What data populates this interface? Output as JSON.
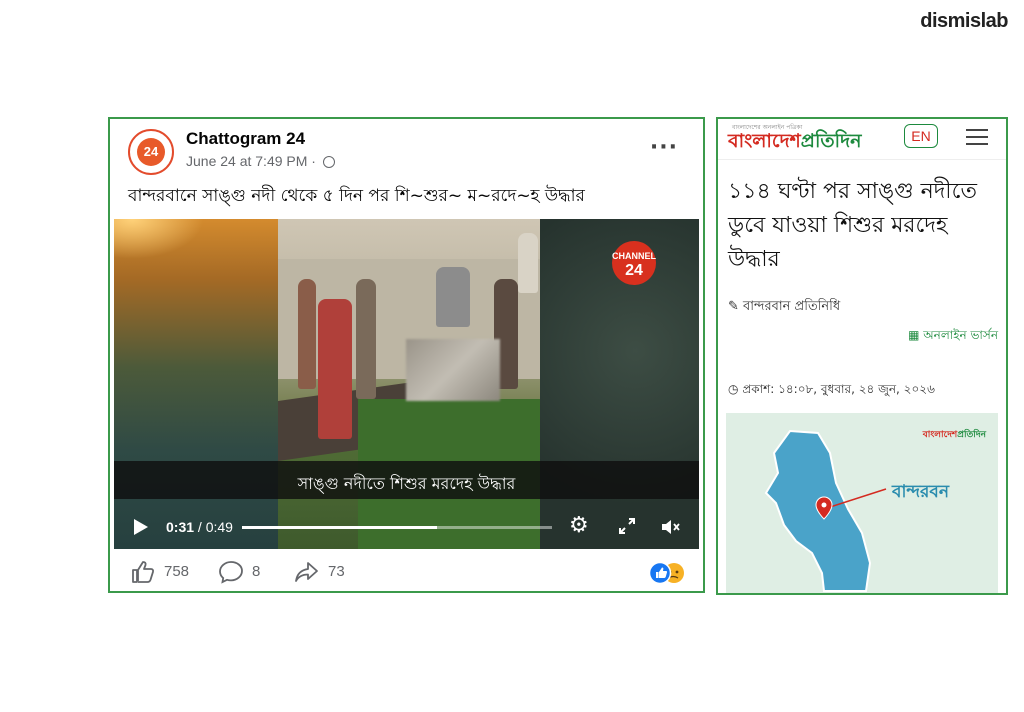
{
  "brand": "dismislab",
  "facebook_post": {
    "page_name": "Chattogram 24",
    "avatar_text": "24",
    "date": "June 24 at 7:49 PM",
    "separator": " · ",
    "post_text": "বান্দরবানে সাঙ্গু নদী থেকে ৫ দিন পর শি~শুর~ ম~রদে~হ উদ্ধার",
    "video": {
      "channel_logo_top": "CHANNEL",
      "channel_logo_num": "24",
      "caption": "সাঙ্গু নদীতে শিশুর মরদেহ উদ্ধার",
      "current_time": "0:31",
      "time_separator": " / ",
      "duration": "0:49",
      "progress": 0.63
    },
    "actions": {
      "likes": "758",
      "comments": "8",
      "shares": "73"
    },
    "colors": {
      "like_blue": "#1877f2",
      "card_border": "#3b9a4b"
    }
  },
  "news_site": {
    "tagline": "বাংলাদেশের অনলাইন পত্রিকা",
    "logo_part1": "বাংলাদেশ",
    "logo_part2": "প্রতিদিন",
    "lang_button": "EN",
    "headline": "১১৪ ঘণ্টা পর সাঙ্গু নদীতে ডুবে যাওয়া শিশুর মরদেহ উদ্ধার",
    "byline": "বান্দরবান প্রতিনিধি",
    "edition": "অনলাইন ভার্সন",
    "published": "প্রকাশ: ১৪:০৮, বুধবার, ২৪ জুন, ২০২৬",
    "map_watermark_1": "বাংলাদেশ",
    "map_watermark_2": "প্রতিদিন",
    "map_label": "বান্দরবন",
    "colors": {
      "logo_red": "#d42a20",
      "logo_green": "#1d8a3e",
      "map_teal": "#2a8cae"
    }
  }
}
